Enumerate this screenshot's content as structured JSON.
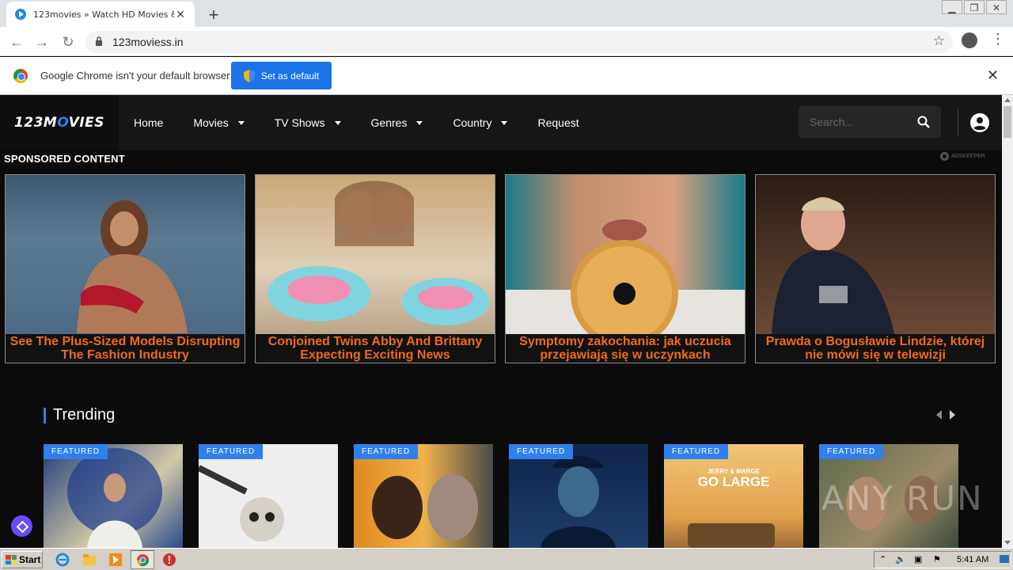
{
  "browser": {
    "tab_title": "123movies » Watch HD Movies & TV",
    "url": "123moviess.in",
    "infobar_message": "Google Chrome isn't your default browser",
    "set_default_label": "Set as default"
  },
  "site": {
    "logo_pre": "123M",
    "logo_mid": "O",
    "logo_post": "VIES",
    "nav": [
      {
        "label": "Home"
      },
      {
        "label": "Movies"
      },
      {
        "label": "TV Shows"
      },
      {
        "label": "Genres"
      },
      {
        "label": "Country"
      },
      {
        "label": "Request"
      }
    ],
    "search_placeholder": "Search..."
  },
  "sponsored": {
    "heading": "SPONSORED CONTENT",
    "provider": "ADSKEEPER",
    "cards": [
      {
        "caption": "See The Plus-Sized Models Disrupting The Fashion Industry"
      },
      {
        "caption": "Conjoined Twins Abby And Brittany Expecting Exciting News"
      },
      {
        "caption": "Symptomy zakochania: jak uczucia przejawiają się w uczynkach"
      },
      {
        "caption": "Prawda o Bogusławie Lindzie, której nie mówi się w telewizji"
      }
    ]
  },
  "trending": {
    "heading": "Trending",
    "badge": "FEATURED",
    "posters": [
      {
        "badge": "FEATURED"
      },
      {
        "badge": "FEATURED"
      },
      {
        "badge": "FEATURED"
      },
      {
        "badge": "FEATURED"
      },
      {
        "badge": "FEATURED",
        "poster_text_top": "JERRY & MARGE",
        "poster_text_main": "GO LARGE"
      },
      {
        "badge": "FEATURED"
      }
    ]
  },
  "watermark": "ANY RUN",
  "taskbar": {
    "start_label": "Start",
    "clock": "5:41 AM"
  },
  "colors": {
    "accent": "#2f80ed",
    "caption": "#f26a1b",
    "page_bg": "#0b0b0b"
  }
}
